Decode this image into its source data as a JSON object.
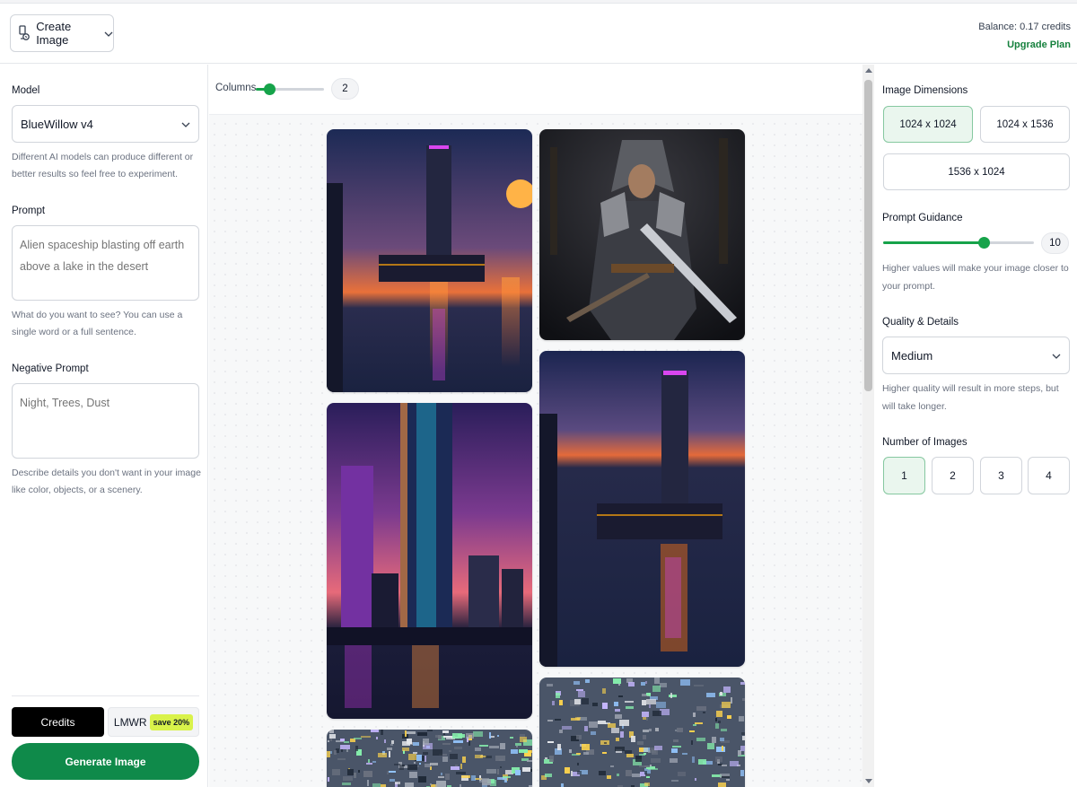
{
  "header": {
    "mode_label": "Create Image",
    "mode_icon": "image-mode-icon",
    "balance_text": "Balance: 0.17 credits",
    "upgrade_label": "Upgrade Plan"
  },
  "left": {
    "model": {
      "label": "Model",
      "value": "BlueWillow v4",
      "help": "Different AI models can produce different or better results so feel free to experiment."
    },
    "prompt": {
      "label": "Prompt",
      "placeholder": "Alien spaceship blasting off earth above a lake in the desert",
      "help": "What do you want to see? You can use a single word or a full sentence."
    },
    "negative_prompt": {
      "label": "Negative Prompt",
      "placeholder": "Night, Trees, Dust",
      "help": "Describe details you don't want in your image like color, objects, or a scenery."
    },
    "payment": {
      "credits_label": "Credits",
      "lmwr_label": "LMWR",
      "save_badge": "save 20%"
    },
    "generate_label": "Generate Image"
  },
  "center": {
    "columns_label": "Columns",
    "columns_value": "2",
    "columns_min": 1,
    "columns_max": 6,
    "gallery": [
      {
        "name": "sunset-tower-image"
      },
      {
        "name": "hooded-warrior-image"
      },
      {
        "name": "neon-skyscrapers-image"
      },
      {
        "name": "sunset-tower-image-2"
      },
      {
        "name": "glitch-noise-image"
      },
      {
        "name": "glitch-noise-image-2"
      }
    ]
  },
  "right": {
    "dimensions": {
      "label": "Image Dimensions",
      "options": [
        "1024 x 1024",
        "1024 x 1536",
        "1536 x 1024"
      ],
      "selected": "1024 x 1024"
    },
    "guidance": {
      "label": "Prompt Guidance",
      "value": "10",
      "min": 0,
      "max": 15,
      "help": "Higher values will make your image closer to your prompt."
    },
    "quality": {
      "label": "Quality & Details",
      "value": "Medium",
      "help": "Higher quality will result in more steps, but will take longer."
    },
    "num_images": {
      "label": "Number of Images",
      "options": [
        "1",
        "2",
        "3",
        "4"
      ],
      "selected": "1"
    }
  },
  "colors": {
    "accent_green": "#0f8a4a",
    "slider_green": "#16a34a",
    "selected_bg": "#eaf6ee",
    "badge_yellow": "#d9f24a"
  }
}
